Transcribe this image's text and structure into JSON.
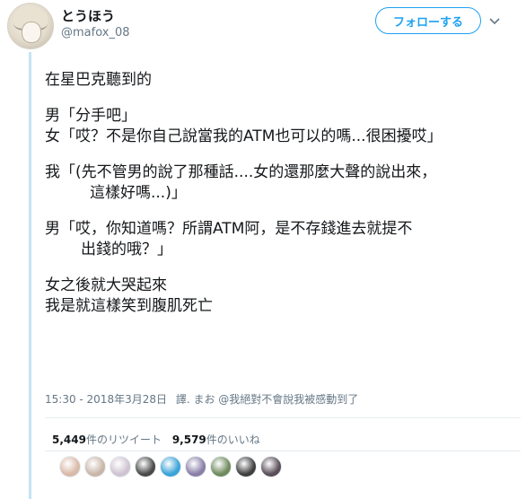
{
  "user": {
    "display_name": "とうほう",
    "handle": "@mafox_08",
    "avatar_icon": "anime-girl-avatar"
  },
  "follow_button_label": "フォローする",
  "tweet_lines": {
    "l1": "在星巴克聽到的",
    "l2": "男「分手吧」",
    "l3": "女「哎？不是你自己說當我的ATM也可以的嗎...很困擾哎」",
    "l4": "我「(先不管男的說了那種話....女的還那麼大聲的說出來，",
    "l5": "這樣好嗎...)」",
    "l6": "男「哎，你知道嗎？所謂ATM阿，是不存錢進去就提不",
    "l7": "出錢的哦？」",
    "l8": "女之後就大哭起來",
    "l9": "我是就這樣笑到腹肌死亡"
  },
  "meta": {
    "timestamp": "15:30 - 2018年3月28日",
    "translation_note": "譯. まお @我絕對不會說我被感動到了"
  },
  "stats": {
    "retweets_count": "5,449",
    "retweets_label": "件のリツイート",
    "likes_count": "9,579",
    "likes_label": "件のいいね"
  },
  "likers": [
    {
      "name": "liker-avatar-1",
      "color": "#d9b9a8"
    },
    {
      "name": "liker-avatar-2",
      "color": "#c9b6a9"
    },
    {
      "name": "liker-avatar-3",
      "color": "#cfc3d2"
    },
    {
      "name": "liker-avatar-4",
      "color": "#4a4a4a"
    },
    {
      "name": "liker-avatar-5",
      "color": "#3aa3d8"
    },
    {
      "name": "liker-avatar-6",
      "color": "#8a7fa8"
    },
    {
      "name": "liker-avatar-7",
      "color": "#6f8a5c"
    },
    {
      "name": "liker-avatar-8",
      "color": "#3f3f3f"
    },
    {
      "name": "liker-avatar-9",
      "color": "#5a4e58"
    }
  ],
  "colors": {
    "accent": "#1da1f2",
    "thread_line": "#c4e4f6",
    "secondary_text": "#657786"
  }
}
